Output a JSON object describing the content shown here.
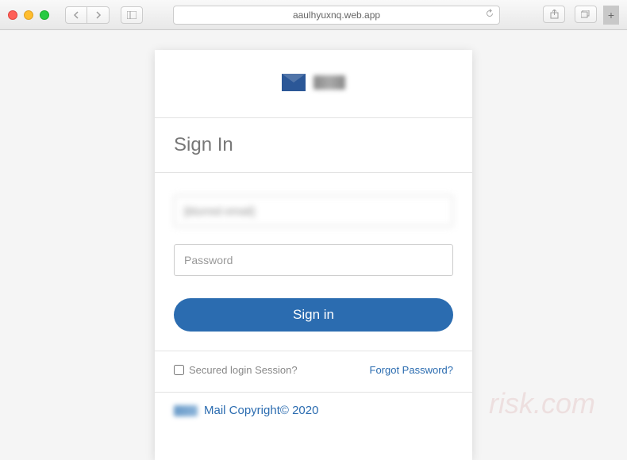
{
  "browser": {
    "url": "aaulhyuxnq.web.app"
  },
  "header": {
    "brand_blurred": "[blurred]"
  },
  "signin": {
    "title": "Sign In",
    "username_value": "[blurred email]",
    "password_placeholder": "Password",
    "button_label": "Sign in"
  },
  "options": {
    "secured_label": "Secured login Session?",
    "forgot_label": "Forgot Password?"
  },
  "footer": {
    "prefix": "[blurred]",
    "text": "Mail Copyright© 2020"
  }
}
